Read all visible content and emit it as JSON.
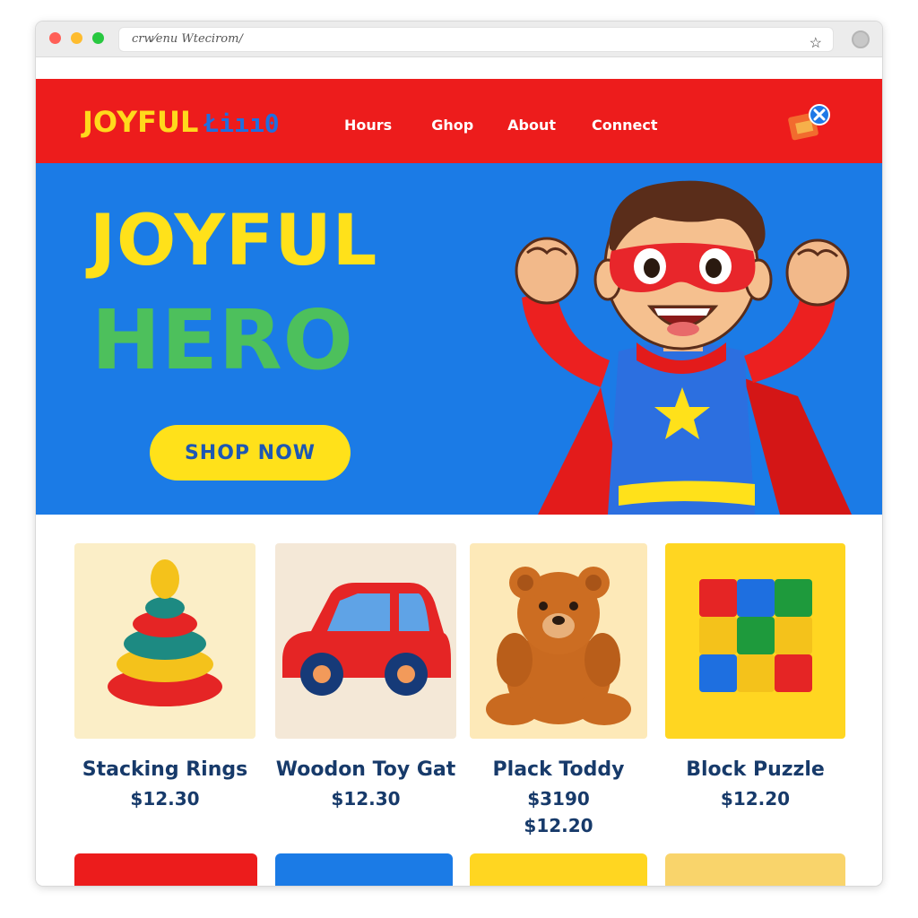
{
  "browser": {
    "url": "crw⁄enu Wtecirom/"
  },
  "nav": {
    "logo_a": "JOYFUL",
    "logo_b": "Łı̇ıı0",
    "links": [
      "Hours",
      "Ghop",
      "About",
      "Connect"
    ]
  },
  "hero": {
    "line1": "JOYFUL",
    "line2": "HERO",
    "cta": "SHOP NOW"
  },
  "products": [
    {
      "name": "Stacking Rings",
      "price": "$12.30",
      "bg": "#fbeec7"
    },
    {
      "name": "Woodon Toy Gat",
      "price": "$12.30",
      "bg": "#f4e8d7"
    },
    {
      "name": "Plack Toddy",
      "price": "$3190",
      "price2": "$12.20",
      "bg": "#fde9b8"
    },
    {
      "name": "Block Puzzle",
      "price": "$12.20",
      "bg": "#ffd621"
    }
  ],
  "row2_colors": [
    "#ec1c1c",
    "#1b7be6",
    "#ffd621",
    "#f9d46b"
  ],
  "colors": {
    "nav": "#ed1c1c",
    "hero": "#1b7be6",
    "yellow": "#ffe11a",
    "green": "#4dc05c",
    "text": "#173a6a"
  }
}
